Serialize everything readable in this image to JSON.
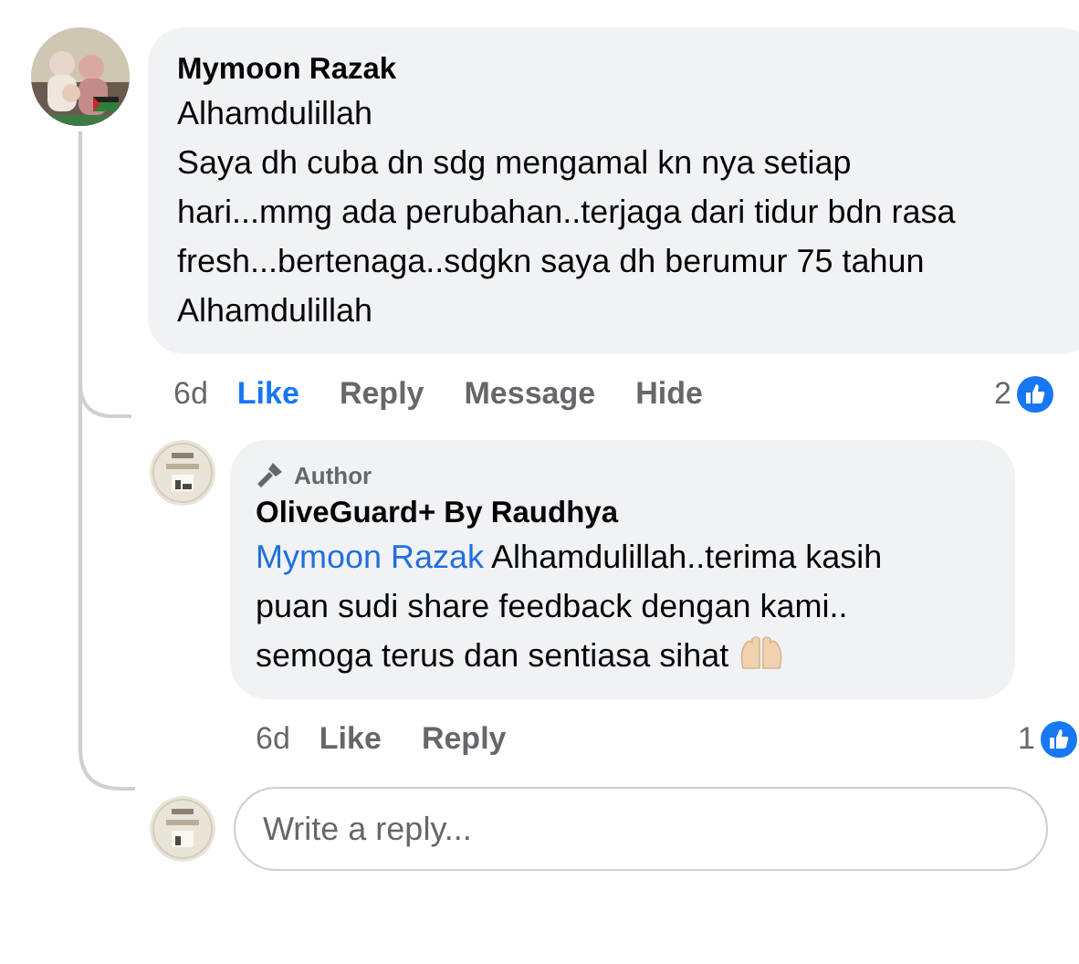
{
  "comment": {
    "author": "Mymoon Razak",
    "paragraphs": [
      "Alhamdulillah",
      "Saya dh cuba dn sdg mengamal kn nya setiap hari...mmg ada perubahan..terjaga dari tidur bdn rasa fresh...bertenaga..sdgkn saya dh berumur 75 tahun",
      "Alhamdulillah"
    ],
    "time": "6d",
    "actions": [
      {
        "label": "Like",
        "selected": true
      },
      {
        "label": "Reply",
        "selected": false
      },
      {
        "label": "Message",
        "selected": false
      },
      {
        "label": "Hide",
        "selected": false
      }
    ],
    "reaction_count": "2"
  },
  "reply": {
    "badge": "Author",
    "author": "OliveGuard+ By Raudhya",
    "mention": "Mymoon Razak",
    "text": "Alhamdulillah..terima kasih puan sudi share feedback dengan kami.. semoga terus dan sentiasa sihat",
    "time": "6d",
    "actions": [
      {
        "label": "Like",
        "selected": false
      },
      {
        "label": "Reply",
        "selected": false
      }
    ],
    "reaction_count": "1"
  },
  "reply_box": {
    "placeholder": "Write a reply..."
  }
}
